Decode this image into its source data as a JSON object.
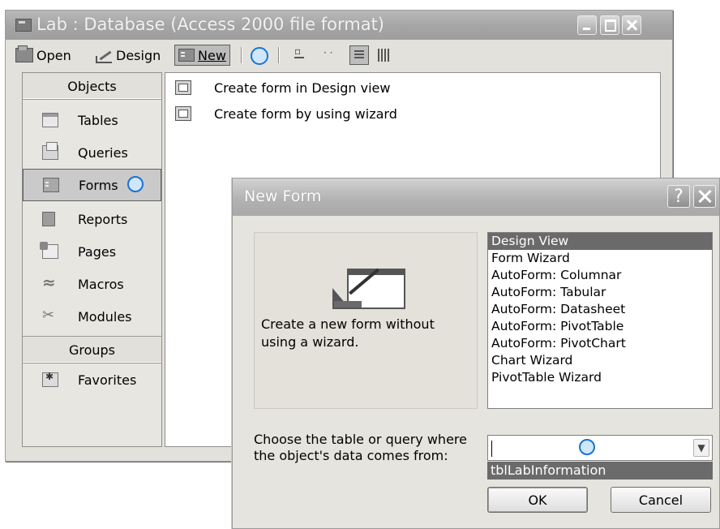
{
  "db_window": {
    "title": "Lab : Database (Access 2000 file format)",
    "toolbar": {
      "open_label": "Open",
      "design_label": "Design",
      "new_label": "New"
    },
    "objects_header": "Objects",
    "objects": [
      {
        "label": "Tables",
        "icon": "table-icon"
      },
      {
        "label": "Queries",
        "icon": "query-icon"
      },
      {
        "label": "Forms",
        "icon": "form-icon",
        "selected": true
      },
      {
        "label": "Reports",
        "icon": "report-icon"
      },
      {
        "label": "Pages",
        "icon": "page-icon"
      },
      {
        "label": "Macros",
        "icon": "macro-icon"
      },
      {
        "label": "Modules",
        "icon": "module-icon"
      }
    ],
    "groups_header": "Groups",
    "groups": [
      {
        "label": "Favorites",
        "icon": "favorites-icon"
      }
    ],
    "shortcuts": [
      "Create form in Design view",
      "Create form by using wizard"
    ]
  },
  "new_form_dialog": {
    "title": "New Form",
    "help_label": "?",
    "preview_text": "Create a new form without using a wizard.",
    "form_types": [
      "Design View",
      "Form Wizard",
      "AutoForm:  Columnar",
      "AutoForm:  Tabular",
      "AutoForm:  Datasheet",
      "AutoForm:  PivotTable",
      "AutoForm:  PivotChart",
      "Chart Wizard",
      "PivotTable Wizard"
    ],
    "selected_type": "Design View",
    "choose_label": "Choose the table or query where the object's data comes from:",
    "source_value": "",
    "source_option": "tblLabInformation",
    "ok_label": "OK",
    "cancel_label": "Cancel"
  },
  "colors": {
    "highlight_circle": "#1a73d0",
    "selection": "#6a6a6a"
  }
}
